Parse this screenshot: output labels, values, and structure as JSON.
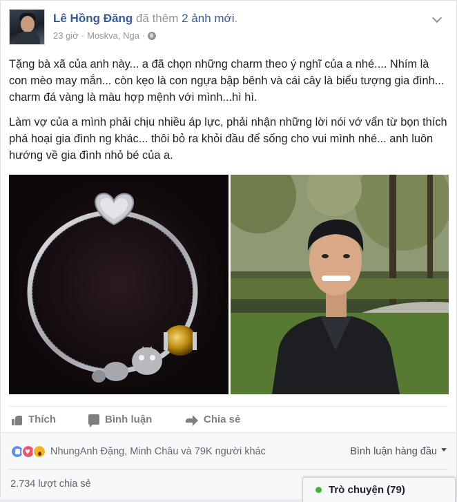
{
  "post": {
    "author": "Lê Hồng Đăng",
    "action_prefix": "đã thêm",
    "action_link": "2 ảnh mới",
    "action_suffix": ".",
    "time": "23 giờ",
    "location": "Moskva, Nga",
    "separator": "·",
    "paragraphs": [
      "Tặng bà xã của anh này... a đã chọn những charm theo ý nghĩ của a nhé.... Nhím là con mèo may mắn... còn kẹo là con ngựa bập bênh và cái cây là biểu tượng gia đình... charm đá vàng là màu hợp mệnh với mình...hì hì.",
      "Làm vợ của a mình phải chịu nhiều áp lực, phải nhận những lời nói vớ vẩn từ bọn thích phá hoại gia đình ng khác... thôi bỏ ra khỏi đầu để sống cho vui mình nhé... anh luôn hướng về gia đình nhỏ bé của a."
    ]
  },
  "actions": {
    "like": "Thích",
    "comment": "Bình luận",
    "share": "Chia sẻ"
  },
  "reactions": {
    "icons": [
      "like-reaction-icon",
      "love-reaction-icon",
      "wow-reaction-icon"
    ],
    "summary": "NhungAnh Đặng, Minh Châu và 79K người khác"
  },
  "comments_filter": "Bình luận hàng đầu",
  "shares": "2.734 lượt chia sẻ",
  "chat": {
    "label": "Trò chuyện (79)",
    "status_color": "#42b72a"
  },
  "colors": {
    "link": "#365899",
    "meta": "#90949c"
  }
}
